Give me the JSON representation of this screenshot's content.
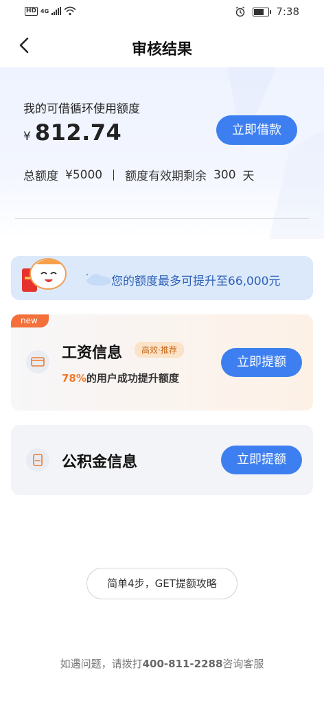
{
  "status": {
    "hd": "HD",
    "network": "4G",
    "time": "7:38"
  },
  "nav": {
    "title": "审核结果"
  },
  "credit": {
    "label": "我的可借循环使用额度",
    "currency": "¥",
    "amount": "812.74",
    "borrow_button": "立即借款",
    "total_label": "总额度",
    "total_value": "¥5000",
    "validity_label": "额度有效期剩余",
    "validity_days": "300",
    "validity_unit": "天"
  },
  "promo": {
    "text": "您的额度最多可提升至66,000元"
  },
  "cards": {
    "salary": {
      "badge": "new",
      "title": "工资信息",
      "tag": "高效·推荐",
      "percent": "78%",
      "subtitle": "的用户成功提升额度",
      "button": "立即提额"
    },
    "fund": {
      "title": "公积金信息",
      "button": "立即提额"
    }
  },
  "guide": {
    "label": "简单4步，GET提额攻略"
  },
  "footer": {
    "prefix": "如遇问题，请拨打",
    "phone": "400-811-2288",
    "suffix": "咨询客服"
  },
  "colors": {
    "primary": "#3d7ff0",
    "accent": "#f07a2a",
    "promo_text": "#2f62b8"
  }
}
